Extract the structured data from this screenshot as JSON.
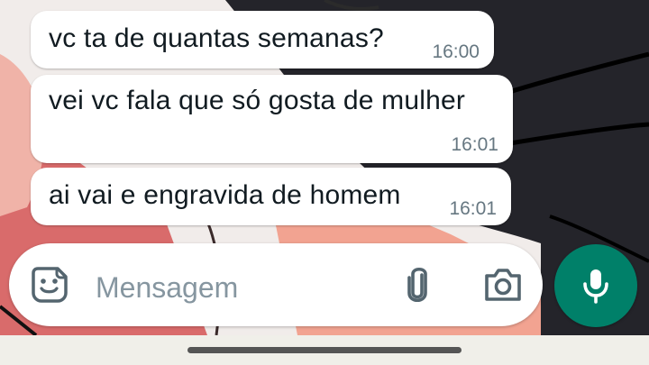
{
  "messages": [
    {
      "text": "vc ta de quantas semanas?",
      "time": "16:00"
    },
    {
      "text": "vei vc fala que só gosta de mulher",
      "time": "16:01"
    },
    {
      "text": "ai vai e engravida de homem",
      "time": "16:01"
    }
  ],
  "composer": {
    "placeholder": "Mensagem",
    "icons": [
      "sticker-icon",
      "attach-paperclip-icon",
      "camera-icon"
    ]
  },
  "send": {
    "icon": "microphone-icon",
    "color": "#008069"
  },
  "colors": {
    "bubble": "#ffffff",
    "timestamp": "#667781",
    "placeholder": "#8696a0",
    "nav_bar": "#f0efe9"
  }
}
